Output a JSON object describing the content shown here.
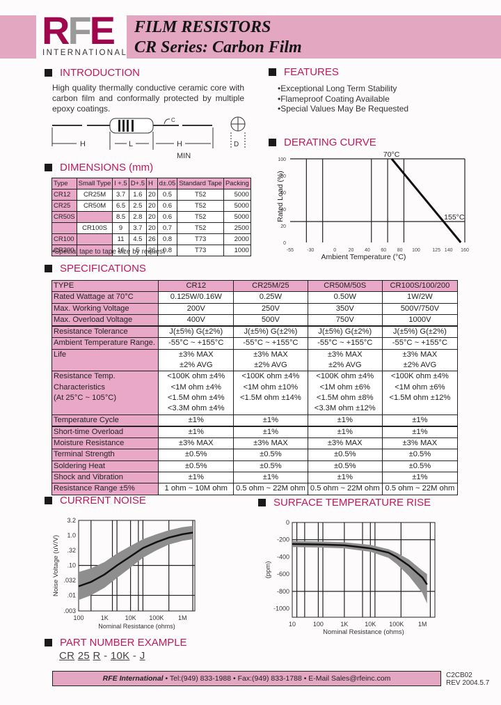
{
  "header": {
    "logo_letters": [
      "R",
      "F",
      "E"
    ],
    "logo_colors": [
      "#a0064c",
      "#9a9a9a",
      "#a0064c"
    ],
    "logo_subtitle": "INTERNATIONAL",
    "title_line1": "FILM RESISTORS",
    "title_line2": "CR Series: Carbon Film",
    "banner_color": "#e4a7c1"
  },
  "introduction": {
    "heading": "INTRODUCTION",
    "text": "High quality thermally conductive ceramic core with carbon film and conformally protected by multiple epoxy coatings.",
    "diagram_labels": {
      "h_left": "H",
      "l": "L",
      "h_right": "H",
      "min": "MIN",
      "d": "D",
      "c": "C"
    }
  },
  "features": {
    "heading": "FEATURES",
    "items": [
      "Exceptional Long Term Stability",
      "Flameproof Coating Available",
      "Special Values May Be Requested"
    ]
  },
  "dimensions": {
    "heading": "DIMENSIONS (mm)",
    "columns": [
      "Type",
      "Small Type",
      "l +.5",
      "D+.5",
      "H",
      "d±.05",
      "Standard Tape",
      "Packing"
    ],
    "rows": [
      [
        "CR12",
        "CR25M",
        "3.7",
        "1.6",
        "20",
        "0.5",
        "T52",
        "5000"
      ],
      [
        "CR25",
        "CR50M",
        "6.5",
        "2.5",
        "20",
        "0.6",
        "T52",
        "5000"
      ],
      [
        "CR50S",
        "",
        "8.5",
        "2.8",
        "20",
        "0.6",
        "T52",
        "5000"
      ],
      [
        "",
        "CR100S",
        "9",
        "3.7",
        "20",
        "0.7",
        "T52",
        "2500"
      ],
      [
        "CR100",
        "",
        "11",
        "4.5",
        "26",
        "0.8",
        "T73",
        "2000"
      ],
      [
        "CR200",
        "",
        "16",
        "5",
        "26",
        "0.8",
        "T73",
        "1000"
      ]
    ],
    "note": "•Special tape to tape size by request"
  },
  "specifications": {
    "heading": "SPECIFICATIONS",
    "header": [
      "TYPE",
      "CR12",
      "CR25M/25",
      "CR50M/50S",
      "CR100S/100/200"
    ],
    "rows": [
      {
        "label": [
          "Rated Wattage at 70°C"
        ],
        "values": [
          [
            "0.125W/0.16W"
          ],
          [
            "0.25W"
          ],
          [
            "0.50W"
          ],
          [
            "1W/2W"
          ]
        ]
      },
      {
        "label": [
          "Max. Working Voltage"
        ],
        "values": [
          [
            "200V"
          ],
          [
            "250V"
          ],
          [
            "350V"
          ],
          [
            "500V/750V"
          ]
        ]
      },
      {
        "label": [
          "Max. Overload Voltage"
        ],
        "values": [
          [
            "400V"
          ],
          [
            "500V"
          ],
          [
            "750V"
          ],
          [
            "1000V"
          ]
        ]
      },
      {
        "label": [
          "Resistance Tolerance"
        ],
        "values": [
          [
            "J(±5%) G(±2%)"
          ],
          [
            "J(±5%) G(±2%)"
          ],
          [
            "J(±5%) G(±2%)"
          ],
          [
            "J(±5%) G(±2%)"
          ]
        ],
        "thick": true
      },
      {
        "label": [
          "Ambient Temperature Range."
        ],
        "values": [
          [
            "-55°C ~ +155°C"
          ],
          [
            "-55°C ~ +155°C"
          ],
          [
            "-55°C ~ +155°C"
          ],
          [
            "-55°C ~ +155°C"
          ]
        ]
      },
      {
        "label": [
          "Life"
        ],
        "values": [
          [
            "±3% MAX",
            "±2% AVG"
          ],
          [
            "±3% MAX",
            "±2% AVG"
          ],
          [
            "±3% MAX",
            "±2% AVG"
          ],
          [
            "±3% MAX",
            "±2% AVG"
          ]
        ]
      },
      {
        "label": [
          "Resistance Temp.",
          "Characteristics",
          "(At 25°C ~ 105°C)"
        ],
        "values": [
          [
            "<100K ohm ±4%",
            "<1M ohm ±4%",
            "<1.5M ohm ±4%",
            "<3.3M ohm ±4%"
          ],
          [
            "<100K ohm ±4%",
            "<1M ohm ±10%",
            "<1.5M ohm ±14%"
          ],
          [
            "<100K ohm ±4%",
            "<1M ohm ±6%",
            "<1.5M ohm ±8%",
            "<3.3M ohm ±12%"
          ],
          [
            "<100K ohm ±4%",
            "<1M ohm ±6%",
            "<1.5M ohm ±12%"
          ]
        ]
      },
      {
        "label": [
          "Temperature Cycle"
        ],
        "values": [
          [
            "±1%"
          ],
          [
            "±1%"
          ],
          [
            "±1%"
          ],
          [
            "±1%"
          ]
        ]
      },
      {
        "label": [
          "Short-time Overload"
        ],
        "values": [
          [
            "±1%"
          ],
          [
            "±1%"
          ],
          [
            "±1%"
          ],
          [
            "±1%"
          ]
        ],
        "thick": true
      },
      {
        "label": [
          "Moisture Resistance"
        ],
        "values": [
          [
            "±3% MAX"
          ],
          [
            "±3% MAX"
          ],
          [
            "±3% MAX"
          ],
          [
            "±3% MAX"
          ]
        ]
      },
      {
        "label": [
          "Terminal Strength"
        ],
        "values": [
          [
            "±0.5%"
          ],
          [
            "±0.5%"
          ],
          [
            "±0.5%"
          ],
          [
            "±0.5%"
          ]
        ]
      },
      {
        "label": [
          "Soldering Heat"
        ],
        "values": [
          [
            "±0.5%"
          ],
          [
            "±0.5%"
          ],
          [
            "±0.5%"
          ],
          [
            "±0.5%"
          ]
        ]
      },
      {
        "label": [
          "Shock and Vibration"
        ],
        "values": [
          [
            "±1%"
          ],
          [
            "±1%"
          ],
          [
            "±1%"
          ],
          [
            "±1%"
          ]
        ]
      },
      {
        "label": [
          "Resistance Range ±5%"
        ],
        "values": [
          [
            "1 ohm ~ 10M ohm"
          ],
          [
            "0.5 ohm ~ 22M ohm"
          ],
          [
            "0.5 ohm ~ 22M ohm"
          ],
          [
            "0.5 ohm ~ 22M ohm"
          ]
        ]
      }
    ]
  },
  "derating": {
    "heading": "DERATING CURVE"
  },
  "current_noise": {
    "heading": "CURRENT NOISE"
  },
  "surface_temp": {
    "heading": "SURFACE TEMPERATURE RISE"
  },
  "part_number": {
    "heading": "PART NUMBER EXAMPLE",
    "parts": [
      "CR",
      "25",
      "R",
      "10K",
      "J"
    ],
    "separators": [
      "",
      "",
      " - ",
      " - "
    ]
  },
  "footer": {
    "company": "RFE International",
    "contact": " • Tel:(949) 833-1988 • Fax:(949) 833-1788 • E-Mail Sales@rfeinc.com",
    "doc_code": "C2CB02",
    "revision": "REV 2004.5.7"
  },
  "chart_data": [
    {
      "id": "derating",
      "type": "line",
      "title": "DERATING CURVE",
      "xlabel": "Ambient Temperature (°C)",
      "ylabel": "Rated Load (%)",
      "x_ticks": [
        -55,
        -30,
        0,
        20,
        40,
        60,
        80,
        100,
        125,
        140,
        160
      ],
      "y_ticks": [
        0,
        20,
        40,
        60,
        80,
        100
      ],
      "xlim": [
        -55,
        160
      ],
      "ylim": [
        0,
        100
      ],
      "vertical_gridlines": [
        -35,
        -15,
        45,
        65,
        85,
        160
      ],
      "horizontal_gridlines": [
        100,
        25
      ],
      "series": [
        {
          "name": "Rated Load",
          "x": [
            70,
            155
          ],
          "y": [
            100,
            0
          ]
        }
      ],
      "annotations": [
        {
          "text": "70°C",
          "x": 70,
          "y": 100
        },
        {
          "text": "155°C",
          "x": 155,
          "y": 25
        }
      ]
    },
    {
      "id": "current_noise",
      "type": "area",
      "title": "CURRENT NOISE",
      "xlabel": "Nominal Resistance (ohms)",
      "ylabel": "Noise Voltage (uV/V)",
      "x_scale": "log",
      "x_ticks": [
        "100",
        "1K",
        "10K",
        "100K",
        "1M"
      ],
      "x_tick_values": [
        100,
        1000,
        10000,
        100000,
        1000000
      ],
      "y_ticks": [
        ".003",
        ".01",
        ".032",
        ".10",
        ".32",
        "1.0",
        "3.2"
      ],
      "xlim": [
        100,
        3000000
      ],
      "ylim": [
        0.003,
        3.2
      ],
      "series": [
        {
          "name": "typical",
          "x": [
            100,
            300,
            1000,
            3000,
            10000,
            30000,
            100000,
            300000,
            1000000,
            2500000
          ],
          "y": [
            0.02,
            0.028,
            0.05,
            0.1,
            0.2,
            0.38,
            0.6,
            0.85,
            1.1,
            1.25
          ]
        },
        {
          "name": "upper",
          "x": [
            100,
            300,
            1000,
            3000,
            10000,
            30000,
            100000,
            300000,
            1000000,
            2500000
          ],
          "y": [
            0.06,
            0.08,
            0.13,
            0.25,
            0.45,
            0.75,
            1.1,
            1.5,
            1.9,
            2.1
          ]
        },
        {
          "name": "lower",
          "x": [
            100,
            300,
            1000,
            3000,
            10000,
            30000,
            100000,
            300000,
            1000000,
            2500000
          ],
          "y": [
            0.007,
            0.01,
            0.018,
            0.038,
            0.085,
            0.18,
            0.32,
            0.5,
            0.66,
            0.75
          ]
        }
      ]
    },
    {
      "id": "surface_temp",
      "type": "area",
      "title": "SURFACE TEMPERATURE RISE",
      "xlabel": "Nominal Resistance (ohms)",
      "ylabel": "(ppm)",
      "x_scale": "log",
      "x_ticks": [
        "10",
        "100",
        "1K",
        "10K",
        "100K",
        "1M"
      ],
      "x_tick_values": [
        10,
        100,
        1000,
        10000,
        100000,
        1000000
      ],
      "y_ticks": [
        "0",
        "-200",
        "-400",
        "-600",
        "-800",
        "-1000"
      ],
      "xlim": [
        10,
        3000000
      ],
      "ylim": [
        -1100,
        0
      ],
      "series": [
        {
          "name": "typical",
          "x": [
            10,
            100,
            1000,
            10000,
            50000,
            100000,
            300000,
            1000000,
            1500000
          ],
          "y": [
            -250,
            -255,
            -265,
            -300,
            -350,
            -400,
            -500,
            -640,
            -720
          ]
        },
        {
          "name": "upper",
          "x": [
            10,
            100,
            1000,
            10000,
            50000,
            100000,
            300000,
            1000000,
            1500000
          ],
          "y": [
            -215,
            -220,
            -230,
            -260,
            -310,
            -350,
            -430,
            -560,
            -600
          ]
        },
        {
          "name": "lower",
          "x": [
            10,
            100,
            1000,
            10000,
            50000,
            100000,
            300000,
            1000000,
            1500000
          ],
          "y": [
            -285,
            -290,
            -300,
            -340,
            -410,
            -480,
            -620,
            -820,
            -940
          ]
        }
      ]
    }
  ]
}
